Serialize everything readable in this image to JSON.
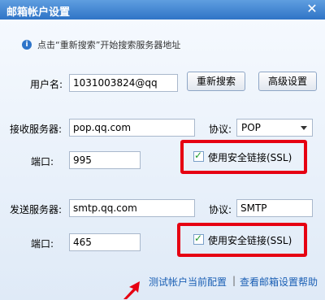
{
  "window": {
    "title": "邮箱帐户设置",
    "close_glyph": "✕"
  },
  "hint": {
    "icon": "i",
    "text": "点击“重新搜索”开始搜索服务器地址"
  },
  "account": {
    "username_label": "用户名:",
    "username_value": "1031003824@qq",
    "research_button": "重新搜索",
    "advanced_button": "高级设置"
  },
  "incoming": {
    "server_label": "接收服务器:",
    "server_value": "pop.qq.com",
    "protocol_label": "协议:",
    "protocol_value": "POP",
    "port_label": "端口:",
    "port_value": "995",
    "ssl_label": "使用安全链接(SSL)",
    "ssl_checked": true
  },
  "outgoing": {
    "server_label": "发送服务器:",
    "server_value": "smtp.qq.com",
    "protocol_label": "协议:",
    "protocol_value": "SMTP",
    "port_label": "端口:",
    "port_value": "465",
    "ssl_label": "使用安全链接(SSL)",
    "ssl_checked": true
  },
  "footer": {
    "test_link": "测试帐户当前配置",
    "separator": "|",
    "help_link": "查看邮箱设置帮助"
  },
  "colors": {
    "title_bar": "#2f74c6",
    "highlight_box": "#e60012",
    "link": "#1a5fb4"
  }
}
